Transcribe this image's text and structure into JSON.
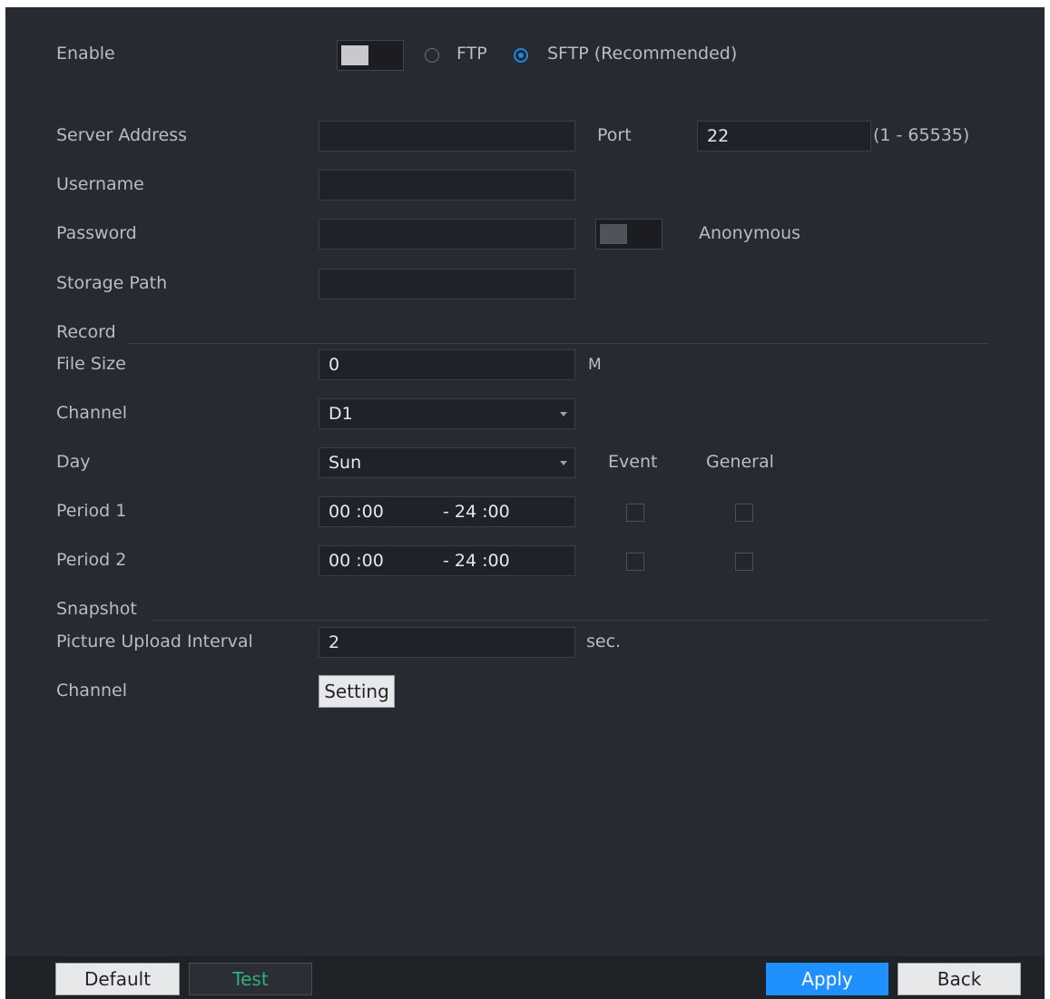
{
  "enable": {
    "label": "Enable",
    "toggle_on": true,
    "protocol_options": [
      "FTP",
      "SFTP (Recommended)"
    ],
    "selected_protocol": "SFTP (Recommended)"
  },
  "server": {
    "address_label": "Server Address",
    "address_value": "",
    "port_label": "Port",
    "port_value": "22",
    "port_range": "(1 - 65535)"
  },
  "auth": {
    "username_label": "Username",
    "username_value": "",
    "password_label": "Password",
    "password_value": "",
    "anonymous_label": "Anonymous",
    "anonymous_on": false
  },
  "storage": {
    "path_label": "Storage Path",
    "path_value": ""
  },
  "record": {
    "section_title": "Record",
    "file_size_label": "File Size",
    "file_size_value": "0",
    "file_size_unit": "M",
    "channel_label": "Channel",
    "channel_value": "D1",
    "day_label": "Day",
    "day_value": "Sun",
    "event_header": "Event",
    "general_header": "General",
    "periods": [
      {
        "label": "Period 1",
        "start": "00 :00",
        "end": "- 24 :00",
        "event": false,
        "general": false
      },
      {
        "label": "Period 2",
        "start": "00 :00",
        "end": "- 24 :00",
        "event": false,
        "general": false
      }
    ]
  },
  "snapshot": {
    "section_title": "Snapshot",
    "interval_label": "Picture Upload Interval",
    "interval_value": "2",
    "interval_unit": "sec.",
    "channel_label": "Channel",
    "setting_button": "Setting"
  },
  "footer": {
    "default_button": "Default",
    "test_button": "Test",
    "apply_button": "Apply",
    "back_button": "Back"
  },
  "colors": {
    "panel_bg": "#272a31",
    "accent": "#1e90ff",
    "test_text": "#2fae7a"
  }
}
